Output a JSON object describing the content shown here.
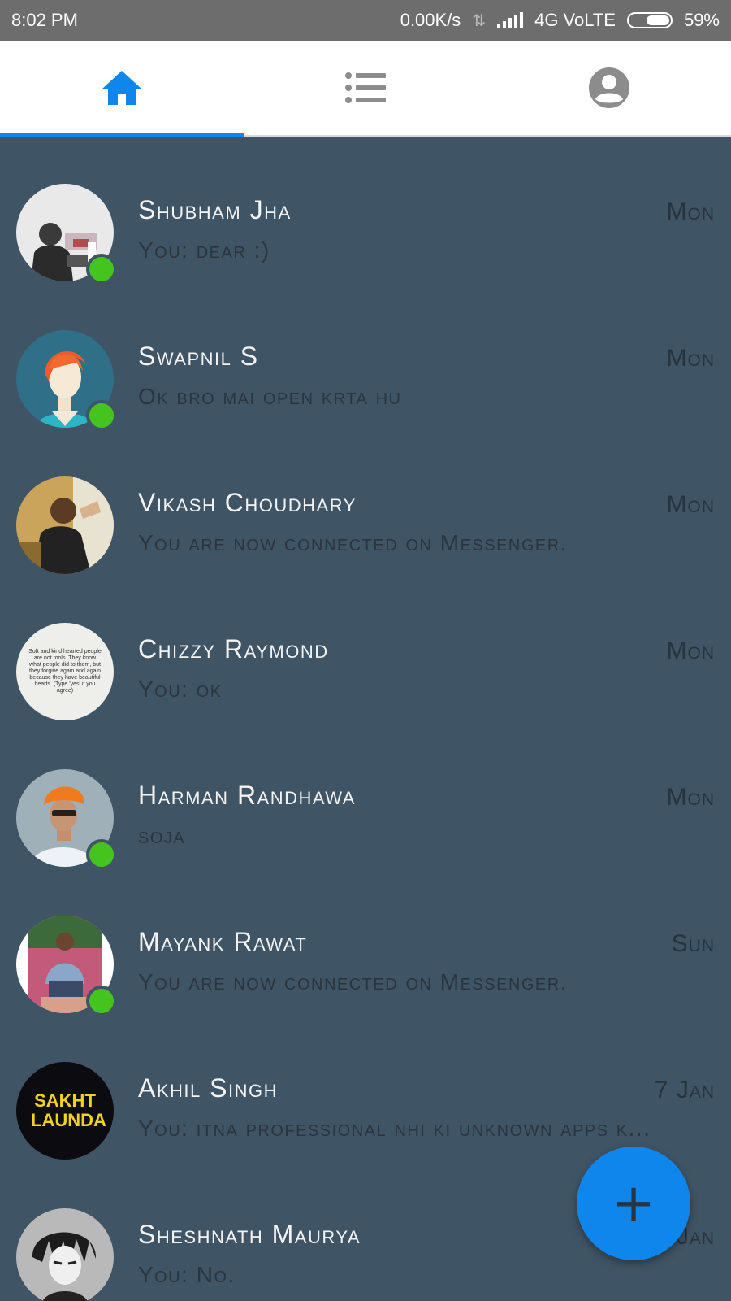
{
  "status_bar": {
    "time": "8:02 PM",
    "net_speed": "0.00K/s",
    "network": "4G VoLTE",
    "battery": "59%"
  },
  "tabs": [
    {
      "icon": "home-icon",
      "active": true
    },
    {
      "icon": "list-icon",
      "active": false
    },
    {
      "icon": "profile-icon",
      "active": false
    }
  ],
  "conversations": [
    {
      "name": "Shubham Jha",
      "preview": "You: dear :)",
      "time": "Mon",
      "online": true
    },
    {
      "name": "Swapnil S",
      "preview": "Ok bro mai open krta hu",
      "time": "Mon",
      "online": true
    },
    {
      "name": "Vikash Choudhary",
      "preview": "You are now connected on Messenger.",
      "time": "Mon",
      "online": false
    },
    {
      "name": "Chizzy Raymond",
      "preview": "You: ok",
      "time": "Mon",
      "online": false,
      "avatar_text": "Soft and kind hearted people are not fools. They know what people did to them, but they forgive again and again because they have beautiful hearts. (Type 'yes' if you agree)"
    },
    {
      "name": "Harman Randhawa",
      "preview": "soja",
      "time": "Mon",
      "online": true
    },
    {
      "name": "Mayank Rawat",
      "preview": "You are now connected on Messenger.",
      "time": "Sun",
      "online": true
    },
    {
      "name": "Akhil Singh",
      "preview": "You: itna professional nhi ki unknown apps k...",
      "time": "7 Jan",
      "online": false,
      "avatar_text": "SAKHT LAUNDA"
    },
    {
      "name": "Sheshnath Maurya",
      "preview": "You: No.",
      "time": "7 Jan",
      "online": false
    }
  ],
  "fab": {
    "icon": "plus-icon",
    "label": "+"
  },
  "colors": {
    "background": "#3f5464",
    "accent": "#0f86ec",
    "online": "#45c41f",
    "status_bar": "#6d6d6d"
  }
}
